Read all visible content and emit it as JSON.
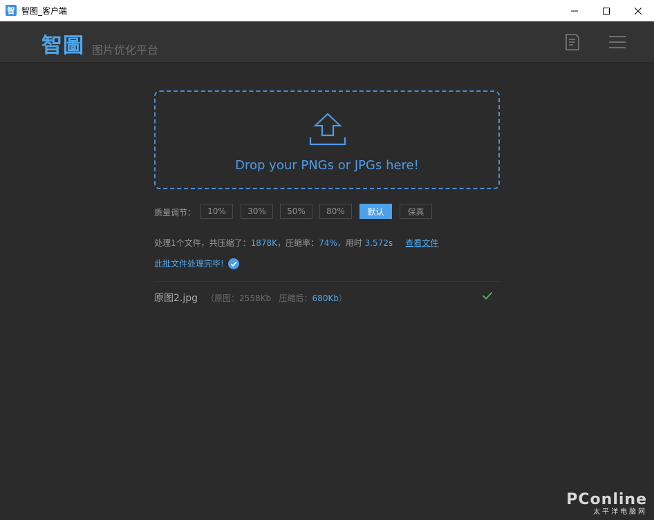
{
  "window": {
    "app_icon_glyph": "智",
    "title": "智图_客户端"
  },
  "header": {
    "logo": "智圖",
    "subtitle": "图片优化平台",
    "icons": [
      "document-icon",
      "menu-icon"
    ]
  },
  "dropzone": {
    "text": "Drop your PNGs or JPGs here!",
    "icon": "upload-icon"
  },
  "quality": {
    "label": "质量调节：",
    "options": [
      "10%",
      "30%",
      "50%",
      "80%",
      "默认",
      "保真"
    ],
    "selected": "默认"
  },
  "stats": {
    "prefix": "处理1个文件，共压缩了：",
    "saved": "1878K",
    "ratio_label": "，压缩率：",
    "ratio": "74%",
    "time_label": "，用时 ",
    "time": "3.572s",
    "view_link": "查看文件"
  },
  "status": {
    "done_text": "此批文件处理完毕!"
  },
  "files": [
    {
      "name": "原图2.jpg",
      "orig_label": "（原图：",
      "orig_size": "2558Kb",
      "comp_label": "压缩后：",
      "comp_size": "680Kb",
      "close_paren": "）"
    }
  ],
  "watermark": {
    "main": "PConline",
    "sub": "太平洋电脑网"
  },
  "colors": {
    "accent": "#4ea6ea",
    "background": "#2b2b2b",
    "header": "#333333",
    "success": "#5cb85c"
  }
}
